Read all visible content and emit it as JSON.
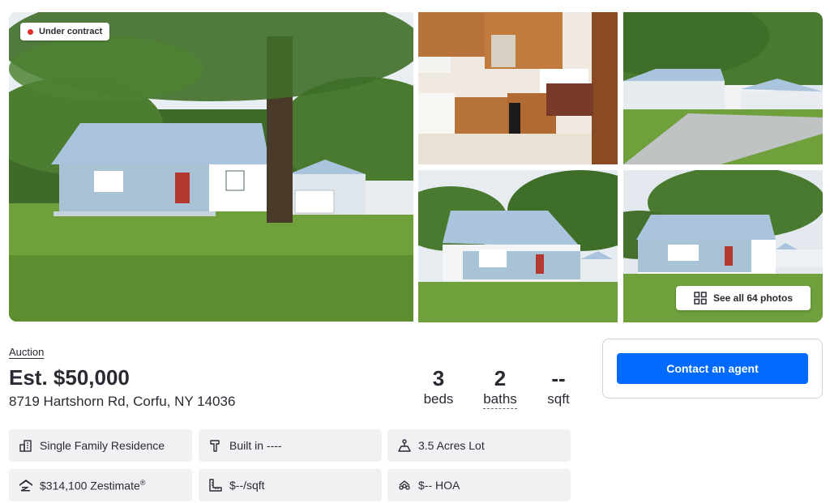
{
  "photos": {
    "status_badge": "Under contract",
    "see_all_label": "See all 64 photos",
    "colors": {
      "status_dot": "#e0312b",
      "grass": "#6fa03c",
      "sky": "#dfe8ef",
      "roof": "#a9c4dc",
      "siding": "#a8c3d6"
    }
  },
  "listing": {
    "sale_type": "Auction",
    "price": "Est. $50,000",
    "address": "8719 Hartshorn Rd, Corfu, NY 14036",
    "stats": {
      "beds_value": "3",
      "beds_label": "beds",
      "baths_value": "2",
      "baths_label": "baths",
      "sqft_value": "--",
      "sqft_label": "sqft"
    }
  },
  "contact": {
    "button_label": "Contact an agent",
    "accent": "#006aff"
  },
  "facts": {
    "type": "Single Family Residence",
    "built": "Built in ----",
    "lot": "3.5 Acres Lot",
    "zestimate": "$314,100 Zestimate",
    "zestimate_mark": "®",
    "price_per_sqft": "$--/sqft",
    "hoa": "$-- HOA",
    "icons": [
      "building-icon",
      "hammer-icon",
      "lot-icon",
      "zillow-icon",
      "ruler-icon",
      "hoa-icon"
    ]
  }
}
